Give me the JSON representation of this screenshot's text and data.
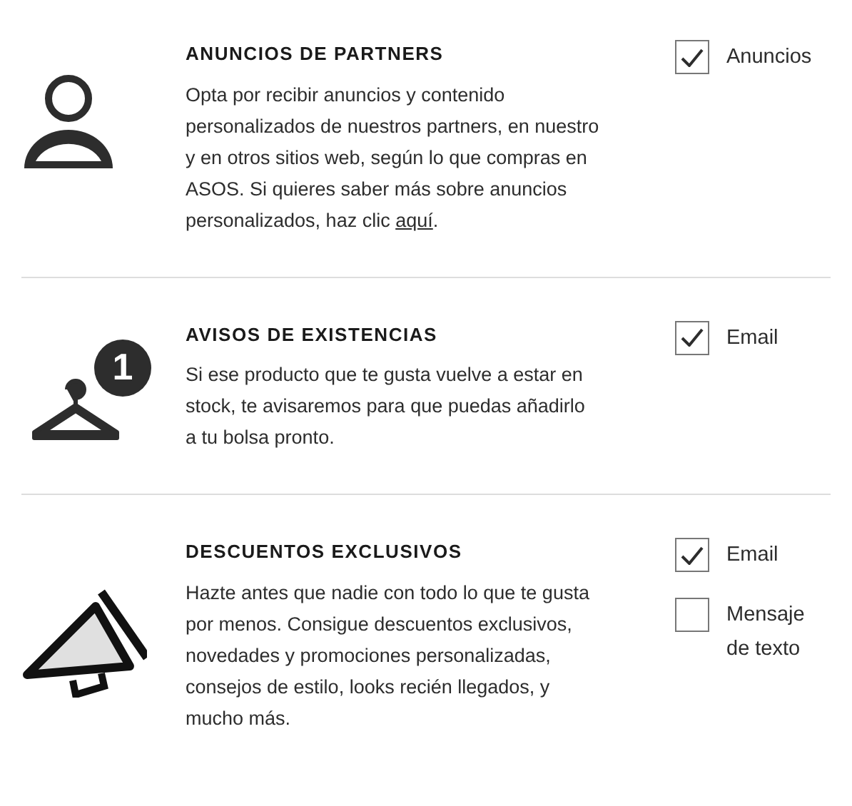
{
  "sections": [
    {
      "kind": "person",
      "title": "ANUNCIOS DE PARTNERS",
      "description": "Opta por recibir anuncios y contenido personalizados de nuestros partners, en nuestro y en otros sitios web, según lo que compras en ASOS. Si quieres saber más sobre anuncios personalizados, haz clic",
      "link": "aquí",
      "after_link": ".",
      "options": [
        {
          "label": "Anuncios",
          "checked": true
        }
      ]
    },
    {
      "kind": "hanger",
      "badge": "1",
      "title": "AVISOS DE EXISTENCIAS",
      "description": "Si ese producto que te gusta vuelve a estar en stock, te avisaremos para que puedas añadirlo a tu bolsa pronto.",
      "options": [
        {
          "label": "Email",
          "checked": true
        }
      ]
    },
    {
      "kind": "megaphone",
      "title": "DESCUENTOS EXCLUSIVOS",
      "description": "Hazte antes que nadie con todo lo que te gusta por menos. Consigue descuentos exclusivos, novedades y promociones personalizadas, consejos de estilo, looks recién llegados, y mucho más.",
      "options": [
        {
          "label": "Email",
          "checked": true
        },
        {
          "label": "Mensaje de texto",
          "checked": false
        }
      ]
    }
  ]
}
